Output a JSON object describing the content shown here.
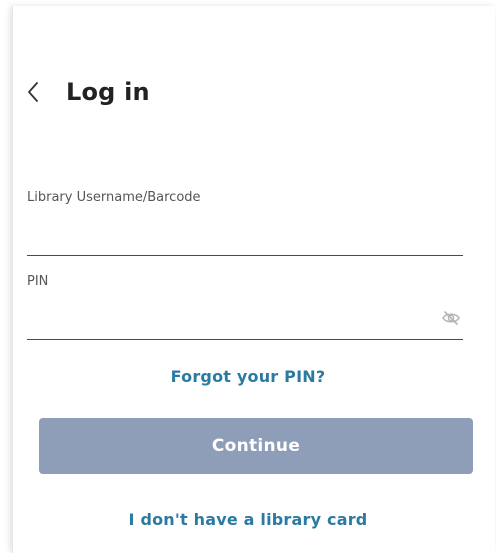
{
  "header": {
    "title": "Log in"
  },
  "form": {
    "username": {
      "label": "Library Username/Barcode",
      "value": ""
    },
    "pin": {
      "label": "PIN",
      "value": ""
    }
  },
  "links": {
    "forgot_pin": "Forgot your PIN?",
    "no_card": "I don't have a library card"
  },
  "actions": {
    "continue_label": "Continue"
  },
  "colors": {
    "link": "#2b7aa1",
    "button_disabled": "#8e9db8",
    "text": "#222222"
  },
  "icons": {
    "back": "chevron-left-icon",
    "pin_visibility": "eye-off-icon"
  }
}
